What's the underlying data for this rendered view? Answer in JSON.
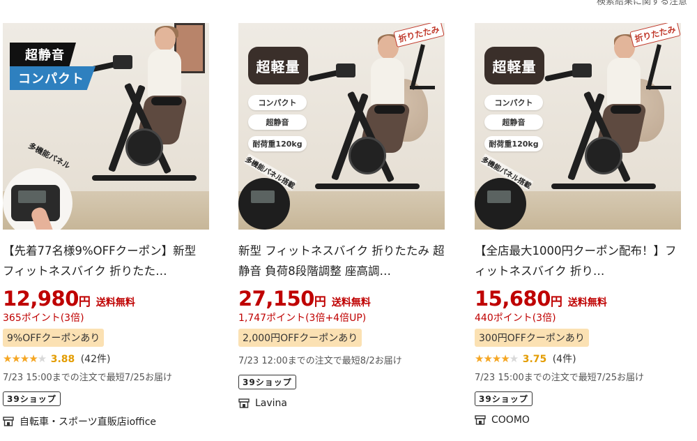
{
  "top_note": "検索結果に関する注意",
  "products": [
    {
      "image_labels": {
        "tag1": "超静音",
        "tag2": "コンパクト",
        "panel_caption": "多機能パネル"
      },
      "title": "【先着77名様9%OFFクーポン】新型 フィットネスバイク 折りたた…",
      "price": "12,980",
      "yen": "円",
      "shipping": "送料無料",
      "points": "365ポイント(3倍)",
      "coupon": "9%OFFクーポンあり",
      "rating": {
        "stars": "★★★★",
        "half": "★",
        "score": "3.88",
        "reviews": "(42件)",
        "value": 3.88
      },
      "delivery": "7/23 15:00までの注文で最短7/25お届け",
      "shop_badge": "39ショップ",
      "store": "自転車・スポーツ直販店ioffice"
    },
    {
      "image_labels": {
        "badge": "超軽量",
        "pill1": "コンパクト",
        "pill2": "超静音",
        "pill3": "耐荷重120kg",
        "folding": "折りたたみ",
        "panel_caption": "多機能パネル搭載"
      },
      "title": "新型 フィットネスバイク 折りたたみ 超静音 負荷8段階調整 座高調…",
      "price": "27,150",
      "yen": "円",
      "shipping": "送料無料",
      "points": "1,747ポイント(3倍+4倍UP)",
      "coupon": "2,000円OFFクーポンあり",
      "delivery": "7/23 12:00までの注文で最短8/2お届け",
      "shop_badge": "39ショップ",
      "store": "Lavina"
    },
    {
      "image_labels": {
        "badge": "超軽量",
        "pill1": "コンパクト",
        "pill2": "超静音",
        "pill3": "耐荷重120kg",
        "folding": "折りたたみ",
        "panel_caption": "多機能パネル搭載"
      },
      "title": "【全店最大1000円クーポン配布！】フィットネスバイク 折り…",
      "price": "15,680",
      "yen": "円",
      "shipping": "送料無料",
      "points": "440ポイント(3倍)",
      "coupon": "300円OFFクーポンあり",
      "rating": {
        "stars": "★★★★",
        "half": "★",
        "score": "3.75",
        "reviews": "(4件)",
        "value": 3.75
      },
      "delivery": "7/23 15:00までの注文で最短7/25お届け",
      "shop_badge": "39ショップ",
      "store": "COOMO"
    }
  ],
  "icons": {
    "store": "store-icon",
    "star": "star-icon"
  },
  "colors": {
    "price_red": "#bf0000",
    "coupon_bg": "#fbe1b3",
    "star": "#f5a623"
  }
}
